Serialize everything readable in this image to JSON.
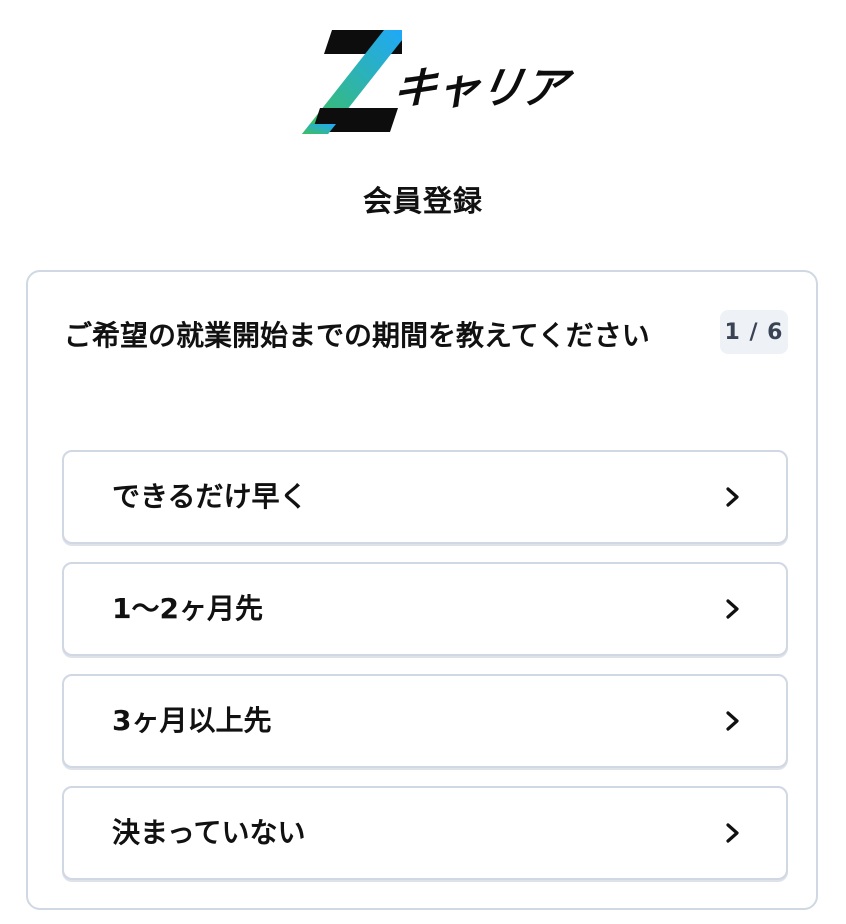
{
  "logo": {
    "text": "キャリア",
    "mark": "Z"
  },
  "page": {
    "title": "会員登録"
  },
  "question": {
    "text": "ご希望の就業開始までの期間を教えてください",
    "step": "1 / 6"
  },
  "options": [
    {
      "label": "できるだけ早く"
    },
    {
      "label": "1〜2ヶ月先"
    },
    {
      "label": "3ヶ月以上先"
    },
    {
      "label": "決まっていない"
    }
  ],
  "icons": {
    "option_arrow": "chevron-right-icon"
  },
  "colors": {
    "border": "#cfd8e3",
    "badge_bg": "#eef1f6",
    "badge_text": "#3a4353",
    "logo_gradient_start": "#3ec05a",
    "logo_gradient_end": "#1ea7ff",
    "text": "#111111"
  }
}
